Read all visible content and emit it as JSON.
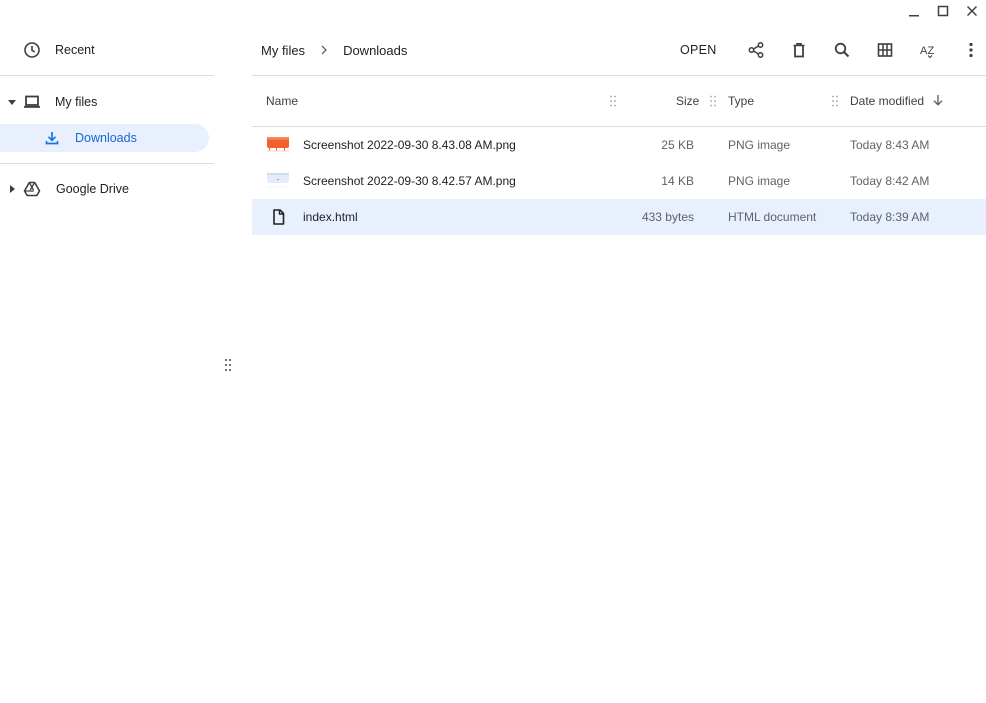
{
  "window": {
    "controls": [
      "minimize-icon",
      "maximize-icon",
      "close-icon"
    ]
  },
  "sidebar": {
    "recent": {
      "label": "Recent",
      "icon": "clock-icon"
    },
    "my_files": {
      "label": "My files",
      "icon": "laptop-icon",
      "expanded": true
    },
    "downloads": {
      "label": "Downloads",
      "icon": "download-icon",
      "selected": true
    },
    "google_drive": {
      "label": "Google Drive",
      "icon": "drive-icon",
      "expanded": false
    }
  },
  "breadcrumb": [
    "My files",
    "Downloads"
  ],
  "toolbar": {
    "open_label": "OPEN",
    "icons": [
      "share-icon",
      "delete-icon",
      "search-icon",
      "grid-view-icon",
      "sort-icon",
      "more-vert-icon"
    ],
    "sort_label": "AZ"
  },
  "table": {
    "columns": {
      "name": "Name",
      "size": "Size",
      "type": "Type",
      "date": "Date modified"
    },
    "sort": {
      "column": "date",
      "direction": "descending"
    },
    "rows": [
      {
        "name": "Screenshot 2022-09-30 8.43.08 AM.png",
        "size": "25 KB",
        "type": "PNG image",
        "date": "Today 8:43 AM",
        "thumb": "orange",
        "selected": false
      },
      {
        "name": "Screenshot 2022-09-30 8.42.57 AM.png",
        "size": "14 KB",
        "type": "PNG image",
        "date": "Today 8:42 AM",
        "thumb": "light",
        "selected": false
      },
      {
        "name": "index.html",
        "size": "433 bytes",
        "type": "HTML document",
        "date": "Today 8:39 AM",
        "thumb": "document",
        "selected": true
      }
    ]
  },
  "colors": {
    "accent": "#1a73e8",
    "selection": "#e8f0fe",
    "thumb_orange": "#f2612f",
    "divider": "#dadce0"
  }
}
